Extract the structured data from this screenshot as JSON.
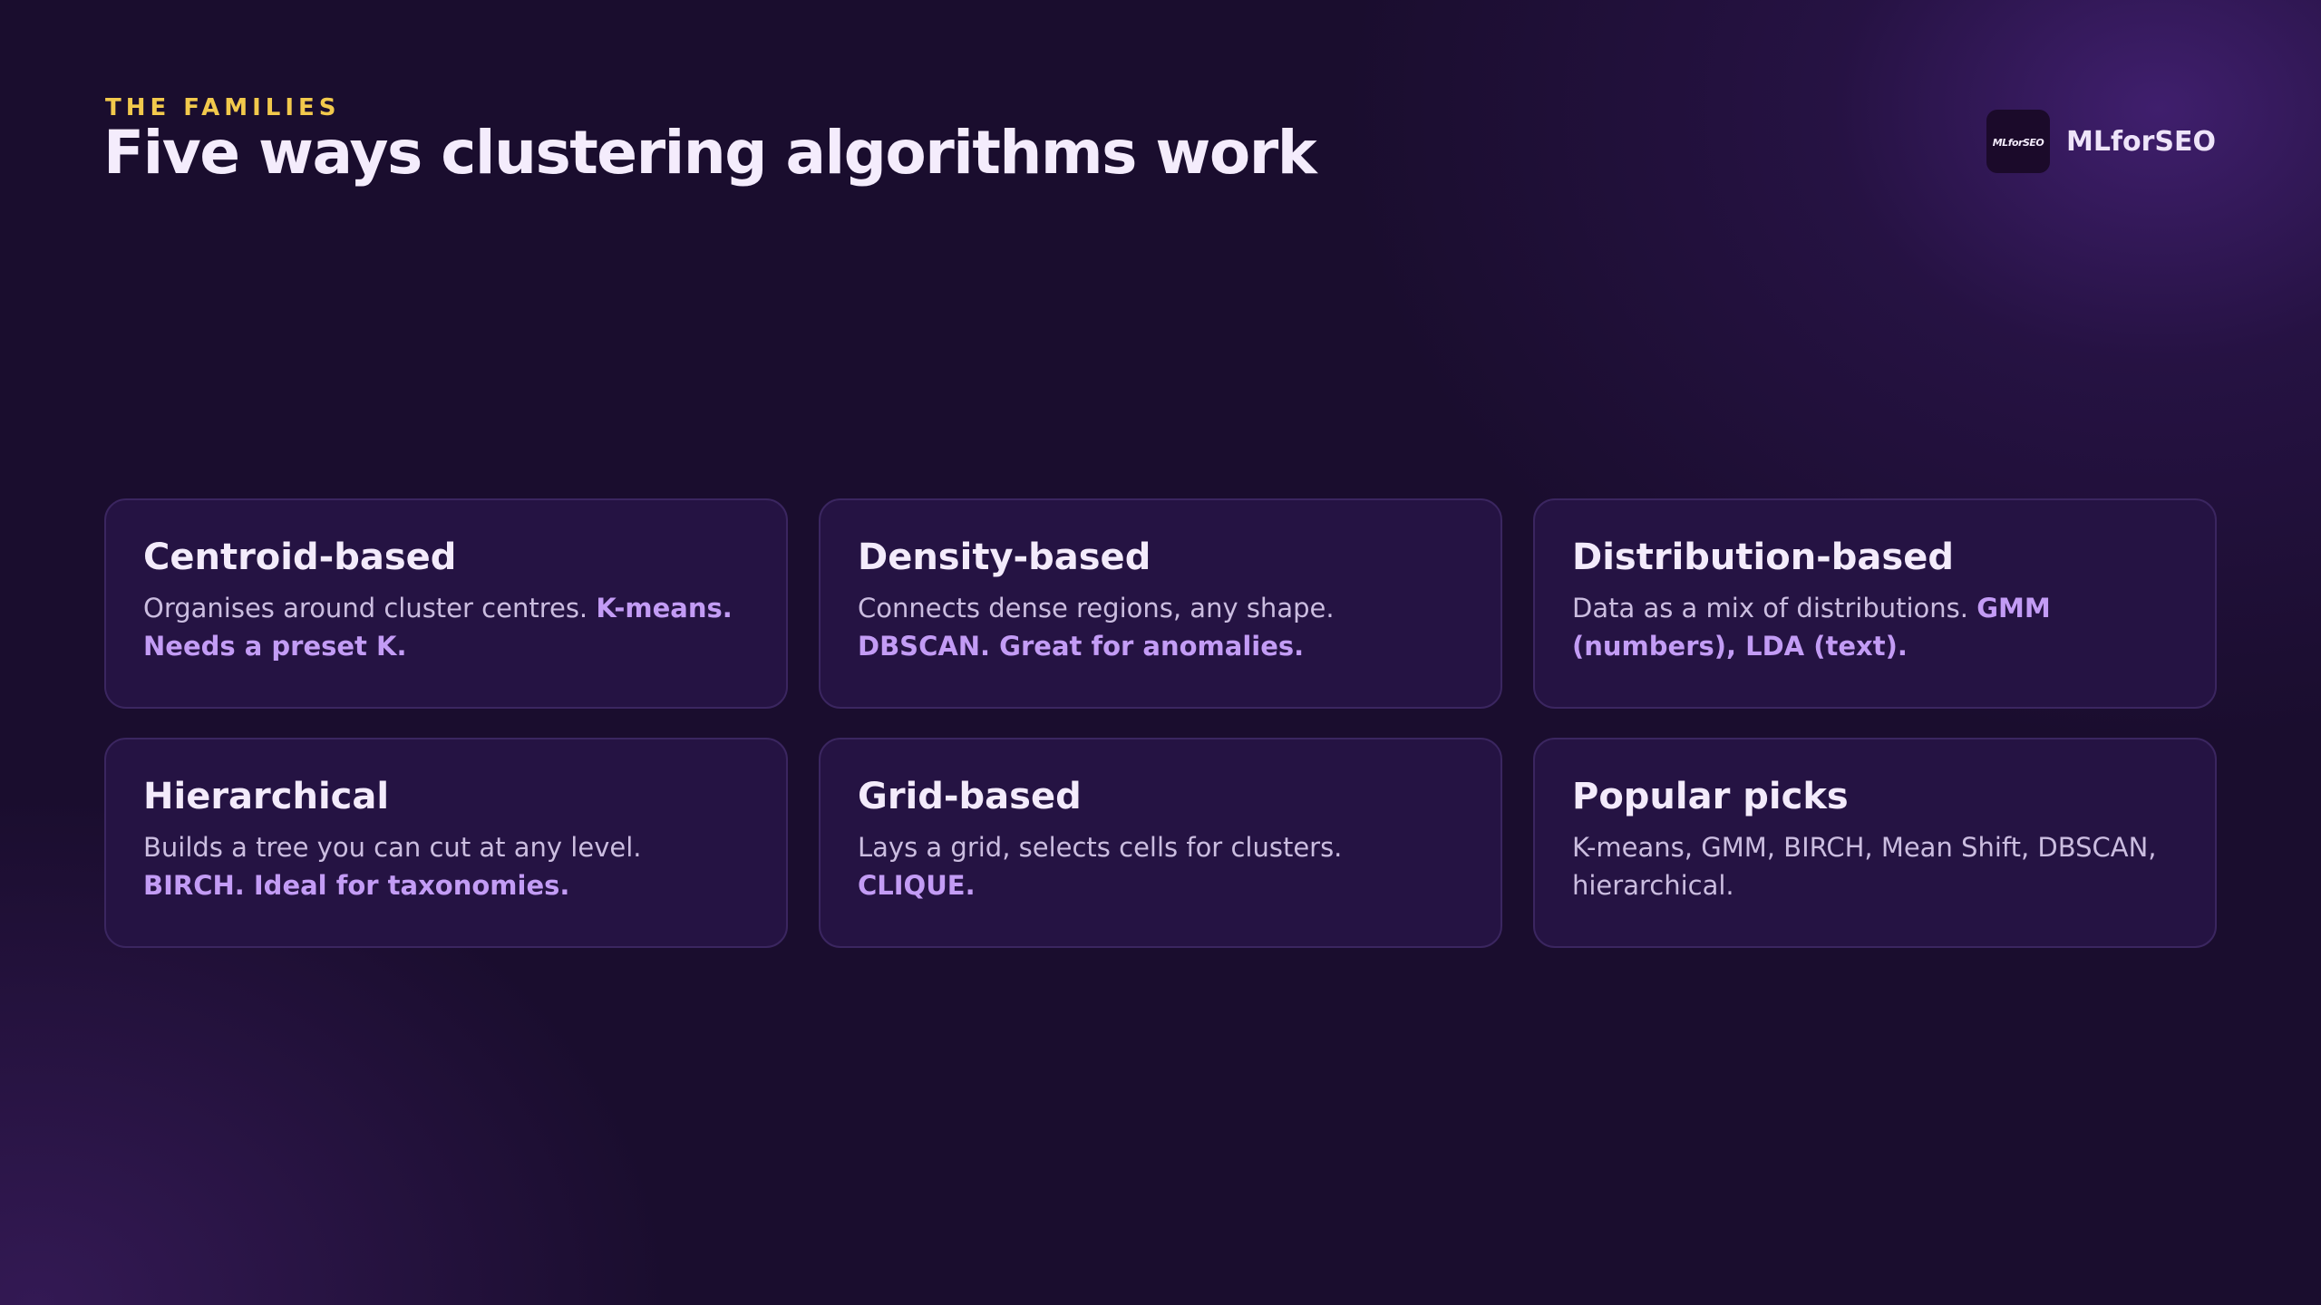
{
  "header": {
    "eyebrow": "THE FAMILIES",
    "title": "Five ways clustering algorithms work"
  },
  "brand": {
    "logo_text": "MLforSEO",
    "name": "MLforSEO"
  },
  "cards": [
    {
      "title": "Centroid-based",
      "text": "Organises around cluster centres. ",
      "highlight": "K-means. Needs a preset K."
    },
    {
      "title": "Density-based",
      "text": "Connects dense regions, any shape. ",
      "highlight": "DBSCAN. Great for anomalies."
    },
    {
      "title": "Distribution-based",
      "text": "Data as a mix of distributions. ",
      "highlight": "GMM (numbers), LDA (text)."
    },
    {
      "title": "Hierarchical",
      "text": "Builds a tree you can cut at any level. ",
      "highlight": "BIRCH. Ideal for taxonomies."
    },
    {
      "title": "Grid-based",
      "text": "Lays a grid, selects cells for clusters. ",
      "highlight": "CLIQUE."
    },
    {
      "title": "Popular picks",
      "text": "K-means, GMM, BIRCH, Mean Shift, DBSCAN, hierarchical.",
      "highlight": ""
    }
  ],
  "colors": {
    "background": "#1a0d2e",
    "eyebrow": "#f2c94c",
    "card_background": "#251343",
    "card_border": "#3b2660",
    "highlight": "#c39cf5"
  }
}
